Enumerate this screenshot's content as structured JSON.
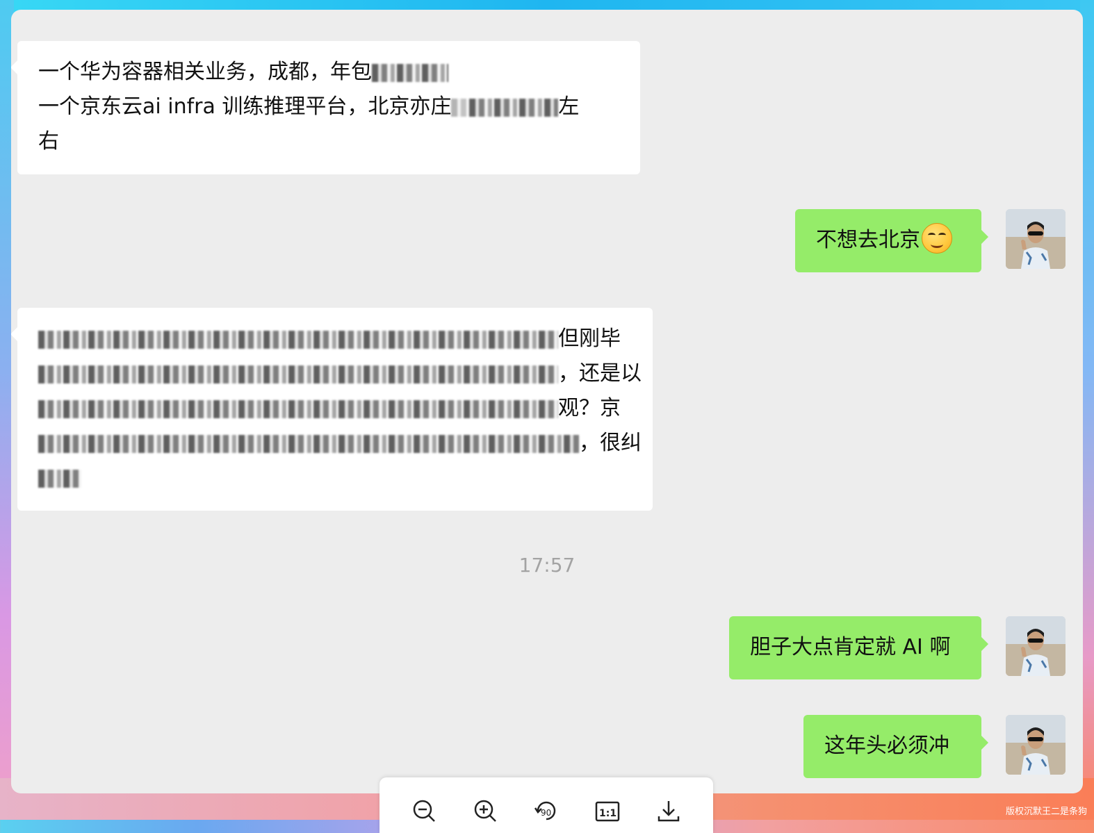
{
  "messages": [
    {
      "side": "left",
      "lines": [
        "一个华为容器相关业务，成都，年包",
        "一个京东云ai infra 训练推理平台，北京亦庄",
        "右"
      ],
      "line2_tail": "左"
    },
    {
      "side": "right",
      "text": "不想去北京",
      "emoji": "grinning-face-emoji"
    },
    {
      "side": "left",
      "fragments": [
        "但刚毕",
        "，还是以",
        "观？京",
        "，很纠"
      ]
    },
    {
      "side": "right",
      "text": "胆子大点肯定就 AI 啊"
    },
    {
      "side": "right",
      "text": "这年头必须冲"
    }
  ],
  "timestamp": "17:57",
  "toolbar": {
    "icons": [
      "zoom-out-icon",
      "zoom-in-icon",
      "rotate-90-icon",
      "actual-size-icon",
      "download-icon"
    ],
    "rotate_label": "90",
    "actual_size_label": "1:1"
  },
  "watermark": "版权沉默王二是条狗"
}
